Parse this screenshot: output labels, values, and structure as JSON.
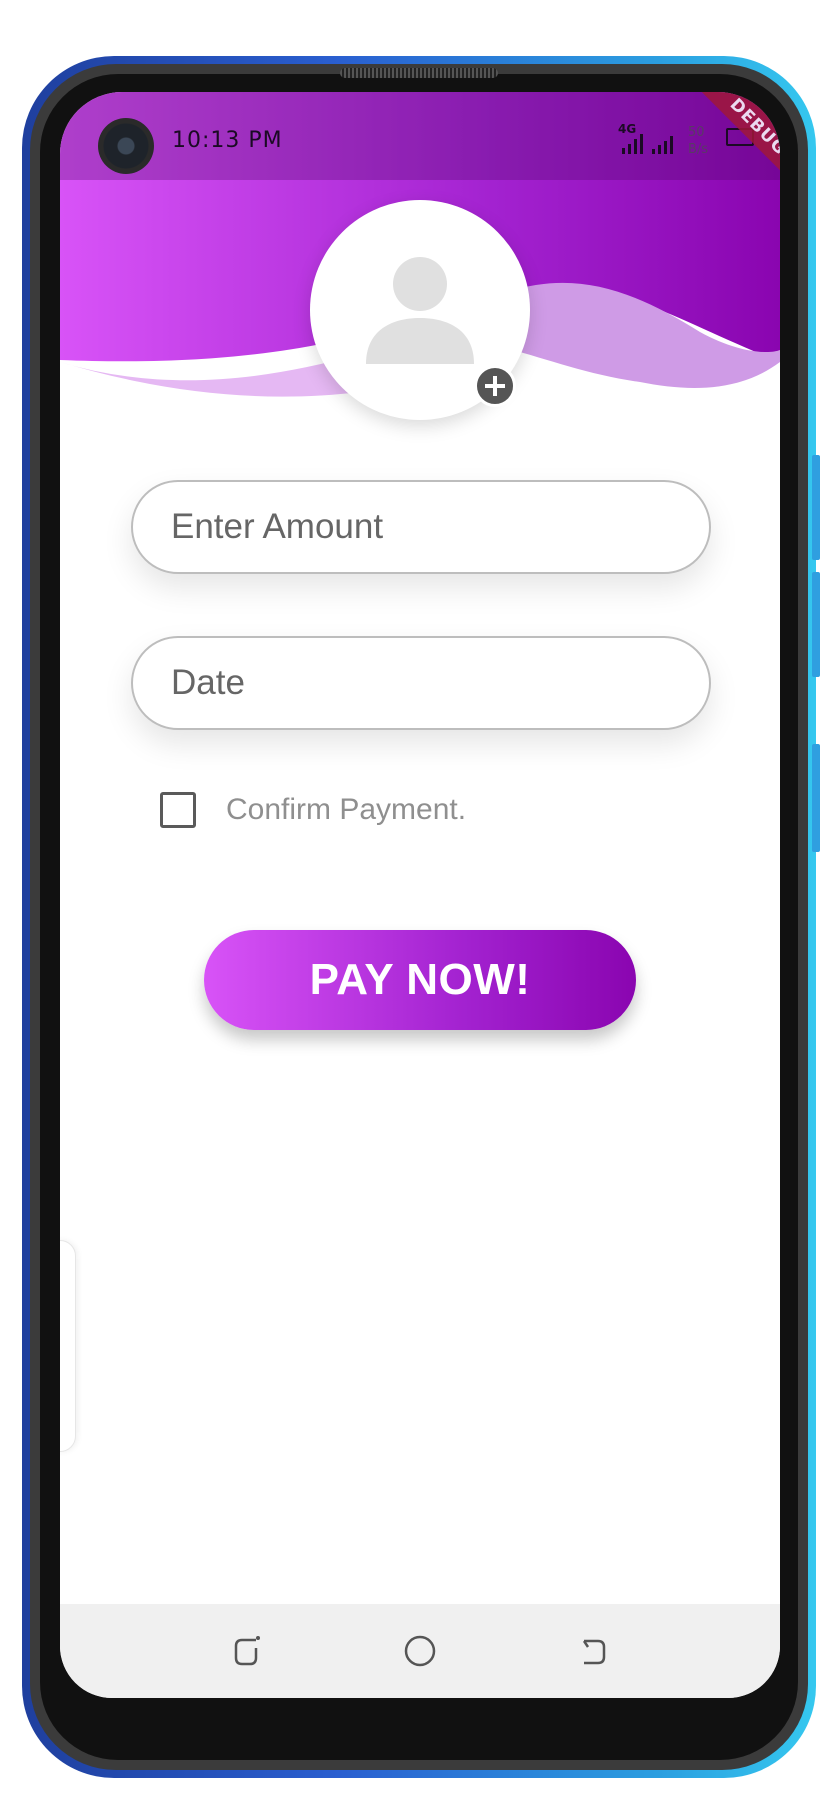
{
  "status_bar": {
    "time": "10:13 PM",
    "network_label": "4G",
    "speed_value": "50",
    "speed_unit": "B/s",
    "debug_banner": "DEBUG"
  },
  "avatar": {
    "icon": "person-icon",
    "add_icon": "plus-icon"
  },
  "form": {
    "amount_placeholder": "Enter Amount",
    "amount_value": "",
    "date_placeholder": "Date",
    "date_value": "",
    "confirm_label": "Confirm Payment.",
    "confirm_checked": false,
    "pay_button_label": "PAY NOW!"
  },
  "nav_bar": {
    "recents_icon": "recents-icon",
    "home_icon": "home-icon",
    "back_icon": "back-icon"
  },
  "colors": {
    "gradient_start": "#d853f7",
    "gradient_end": "#8a05b0",
    "wave_light": "#e5b8f3",
    "wave_mid": "#cf9be6"
  }
}
